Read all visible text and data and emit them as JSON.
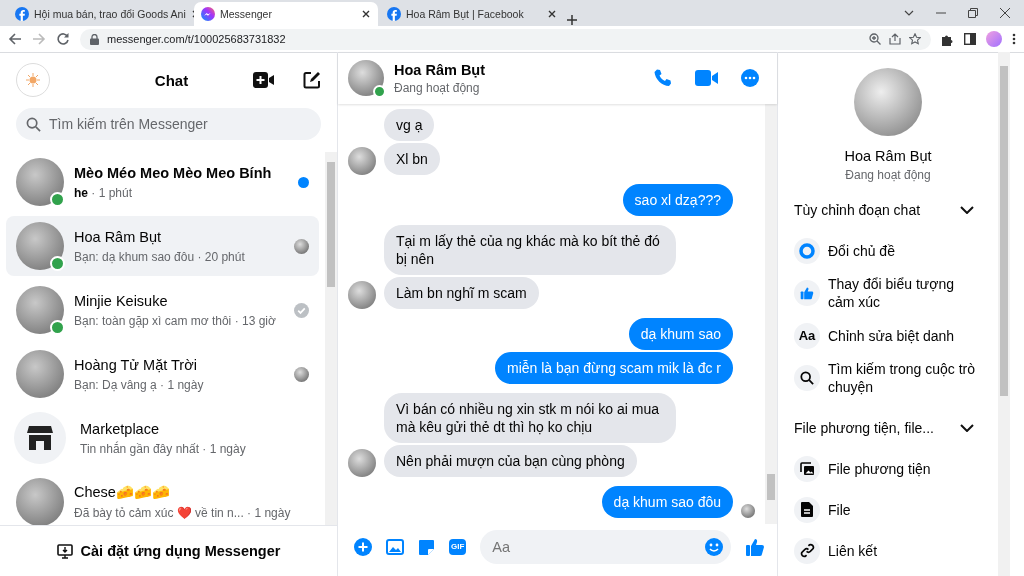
{
  "browser": {
    "tabs": [
      {
        "title": "Hội mua bán, trao đổi Goods Ani",
        "kind": "facebook",
        "selected": false
      },
      {
        "title": "Messenger",
        "kind": "messenger",
        "selected": true
      },
      {
        "title": "Hoa Râm Bụt | Facebook",
        "kind": "facebook",
        "selected": false
      }
    ],
    "url": "messenger.com/t/100025683731832"
  },
  "sidebar": {
    "title": "Chat",
    "search": {
      "placeholder": "Tìm kiếm trên Messenger"
    },
    "conversations": [
      {
        "kind": "person",
        "name": "Mèo Méo Meo Mèo Meo Bính",
        "preview": "he",
        "time": "· 1 phút",
        "unread": true,
        "selected": false,
        "online": true,
        "seen": false,
        "delivered": false
      },
      {
        "kind": "person",
        "name": "Hoa Râm Bụt",
        "preview": "Bạn: dạ khum sao đôu",
        "time": "· 20 phút",
        "unread": false,
        "selected": true,
        "online": true,
        "seen": true,
        "delivered": false
      },
      {
        "kind": "person",
        "name": "Minjie Keisuke",
        "preview": "Bạn: toàn gặp xì cam mơ thôi",
        "time": "· 13 giờ",
        "unread": false,
        "selected": false,
        "online": true,
        "seen": false,
        "delivered": true
      },
      {
        "kind": "person",
        "name": "Hoàng Tử Mặt Trời",
        "preview": "Bạn: Dạ vâng ạ",
        "time": "· 1 ngày",
        "unread": false,
        "selected": false,
        "online": false,
        "seen": true,
        "delivered": false
      },
      {
        "kind": "marketplace",
        "name": "Marketplace",
        "preview": "Tin nhắn gần đây nhất",
        "time": "· 1 ngày",
        "unread": false,
        "selected": false,
        "online": false,
        "seen": false,
        "delivered": false
      },
      {
        "kind": "person",
        "name": "Chese🧀🧀🧀",
        "preview": "Đã bày tỏ cảm xúc ❤️ về tin n...",
        "time": "· 1 ngày",
        "unread": false,
        "selected": false,
        "online": false,
        "seen": false,
        "delivered": false
      }
    ],
    "install_button": "Cài đặt ứng dụng Messenger"
  },
  "conversation": {
    "name": "Hoa Râm Bụt",
    "status": "Đang hoạt động",
    "online": true,
    "messages": [
      {
        "kind": "incoming",
        "text": "vg ạ",
        "avatar": false,
        "seen": false
      },
      {
        "kind": "incoming",
        "text": "Xl bn",
        "avatar": true,
        "seen": false
      },
      {
        "kind": "outgoing",
        "text": "sao xl dzạ???",
        "avatar": false,
        "seen": false
      },
      {
        "kind": "incoming",
        "text": "Tại m lấy thẻ của ng khác mà ko bít thẻ đó bị nên",
        "avatar": false,
        "seen": false
      },
      {
        "kind": "incoming",
        "text": "Làm bn nghĩ m scam",
        "avatar": true,
        "seen": false
      },
      {
        "kind": "outgoing",
        "text": "dạ khum sao",
        "avatar": false,
        "seen": false
      },
      {
        "kind": "outgoing",
        "text": "miễn là bạn đừng scam mik là đc r",
        "avatar": false,
        "seen": false
      },
      {
        "kind": "incoming",
        "text": "Vì bán có nhiều ng xin stk m nói ko ai mua mà kêu gửi thẻ dt thì họ ko chịu",
        "avatar": false,
        "seen": false
      },
      {
        "kind": "incoming",
        "text": "Nên phải mượn của bạn cùng phòng",
        "avatar": true,
        "seen": false
      },
      {
        "kind": "outgoing",
        "text": "dạ khum sao đôu",
        "avatar": false,
        "seen": true
      }
    ],
    "composer": {
      "gif_label": "GIF",
      "placeholder": "Aa"
    }
  },
  "info_panel": {
    "name": "Hoa Râm Bụt",
    "status": "Đang hoạt động",
    "sections": [
      {
        "title": "Tùy chỉnh đoạn chat",
        "expanded": true,
        "items": [
          {
            "kind": "theme",
            "label": "Đổi chủ đề"
          },
          {
            "kind": "emoji",
            "label": "Thay đổi biểu tượng cảm xúc"
          },
          {
            "kind": "nickname",
            "label": "Chỉnh sửa biệt danh",
            "icon_text": "Aa"
          },
          {
            "kind": "search",
            "label": "Tìm kiếm trong cuộc trò chuyện"
          }
        ]
      },
      {
        "title": "File phương tiện, file...",
        "expanded": true,
        "items": [
          {
            "kind": "media",
            "label": "File phương tiện"
          },
          {
            "kind": "file",
            "label": "File"
          },
          {
            "kind": "link",
            "label": "Liên kết"
          }
        ]
      }
    ]
  }
}
